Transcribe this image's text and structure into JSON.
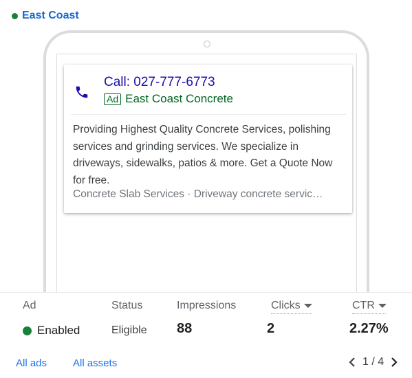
{
  "campaign": {
    "name": "East Coast",
    "status_color": "#188038"
  },
  "ad": {
    "call_text": "Call: 027-777-6773",
    "badge": "Ad",
    "business_name": "East Coast Concrete",
    "description": "Providing Highest Quality Concrete Services, polishing services and grinding services. We specialize in driveways, sidewalks, patios & more. Get a Quote Now for free.",
    "sitelinks": "Concrete Slab Services · Driveway concrete servic…",
    "icon": "phone-icon"
  },
  "stats": {
    "headers": {
      "ad": "Ad",
      "status": "Status",
      "impressions": "Impressions",
      "clicks": "Clicks",
      "ctr": "CTR"
    },
    "values": {
      "ad_state": "Enabled",
      "status": "Eligible",
      "impressions": "88",
      "clicks": "2",
      "ctr": "2.27%"
    }
  },
  "footer": {
    "all_ads": "All ads",
    "all_assets": "All assets",
    "pager": "1 / 4"
  },
  "colors": {
    "link": "#1a73e8",
    "ad_title": "#1a0dab",
    "green": "#006621",
    "enabled": "#188038"
  }
}
